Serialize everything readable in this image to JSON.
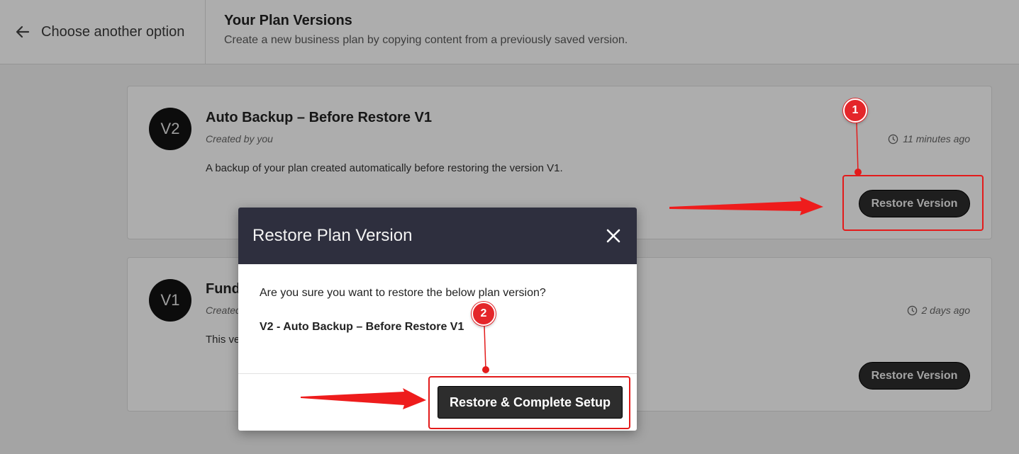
{
  "header": {
    "back_label": "Choose another option",
    "title": "Your Plan Versions",
    "subtitle": "Create a new business plan by copying content from a previously saved version."
  },
  "versions": [
    {
      "badge": "V2",
      "title": "Auto Backup – Before Restore V1",
      "author": "Created by you",
      "time": "11 minutes ago",
      "description": "A backup of your plan created automatically before restoring the version V1.",
      "button": "Restore Version"
    },
    {
      "badge": "V1",
      "title": "Fund",
      "author": "Created",
      "time": "2 days ago",
      "description": "This ve",
      "button": "Restore Version"
    }
  ],
  "modal": {
    "title": "Restore Plan Version",
    "question": "Are you sure you want to restore the below plan version?",
    "version": "V2 - Auto Backup – Before Restore V1",
    "confirm": "Restore & Complete Setup"
  },
  "annotations": {
    "step1": "1",
    "step2": "2",
    "color": "#e31b1b"
  },
  "icons": {
    "back": "arrow-left-icon",
    "time": "clock-icon",
    "close": "close-icon"
  }
}
